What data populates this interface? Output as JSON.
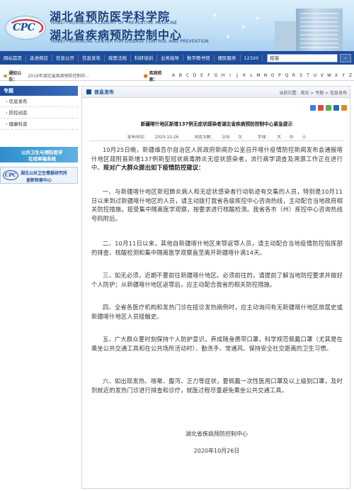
{
  "header": {
    "title_cn_1": "湖北省预防医学科学院",
    "title_en_1": "HUBEI PROVINCIAL ACADEMY OF PREVENTIVE MEDICINE",
    "title_cn_2": "湖北省疾病预防控制中心",
    "title_en_2": "HUBEI PROVINCIAL CENTER FOR DISEASE CONTROL AND PREVENTION",
    "logo_text": "CPC"
  },
  "nav": {
    "items": [
      "网站首页",
      "走进疾控",
      "信息公开",
      "信息发布",
      "政策法规",
      "科研培训",
      "业务指导",
      "数字图书馆",
      "便民服务",
      "12320"
    ],
    "search_value": "疫苗",
    "search_button": "›"
  },
  "notice": {
    "label": "通知公告：",
    "text": "2019年湖北省疾病预防控制中...",
    "disease_label": "疾病检索：",
    "letters": [
      "A",
      "B",
      "C",
      "D",
      "E",
      "F",
      "G",
      "H",
      "I",
      "J",
      "K",
      "L",
      "M",
      "N",
      "O",
      "P",
      "Q",
      "R",
      "S",
      "T",
      "U",
      "V",
      "W",
      "X",
      "Y",
      "Z"
    ]
  },
  "sidebar": {
    "heading": "专题",
    "items": [
      "信息发布",
      "防控动态",
      "健康科普"
    ],
    "banner1_text_1": "公共卫生与预防医学",
    "banner1_text_2": "在线审稿系统",
    "banner2_logo": "CPC",
    "banner2_text_1": "湖北公共卫生情报研究所",
    "banner2_text_2": "查新检索中心"
  },
  "content": {
    "section_title": "信息发布",
    "breadcrumb": "当前位置：首页 > 专题 > 信息发布",
    "article_title": "新疆喀什地区新增137例无症状感染者湖北省疾病预防控制中心紧急提示",
    "meta": {
      "date_label": "发布时间：",
      "date": "2020-10-26",
      "views_label": "浏览次数：",
      "views": "109",
      "views_unit": "次",
      "font_label": "字体：",
      "font_big": "大",
      "font_mid": "中",
      "font_small": "小"
    },
    "intro": "10月25日晚，新疆维吾尔自治区人民政府新闻办公室召开喀什疫情防控新闻发布会通报喀什地区疏附县新增137例新型冠状病毒肺炎无症状感染者，流行病学调查及溯源工作正在进行中。",
    "intro_bold": "现对广大群众提出如下疫情防控建议：",
    "points": [
      "一、与新疆喀什地区新冠肺炎病人和无症状感染者行动轨迹有交集的人员，特别是10月11日以来到过新疆喀什地区的人员，请主动拨打我省各级疾控中心咨询热线，主动配合当地政府相关防控措施，接受集中隔离医学观察，按要求进行核酸检测。我省各市（州）疾控中心咨询热线号码附后。",
      "二、10月11日以来，其他自新疆喀什地区来鄂返鄂人员，请主动配合当地疫情防控指挥部的排查、核酸检测和集中隔离医学观察直至离开新疆喀什满14天。",
      "三、如无必须，近期不要前往新疆喀什地区。必须前往的，请提前了解当地防控要求并做好个人防护；从新疆喀什地区返鄂后，应主动配合我省的相关防控措施。",
      "四、全省各医疗机构和发热门诊在接诊发热病例时，应主动询问有无新疆喀什地区旅居史或新疆喀什地区人员接触史。",
      "五、广大群众要时刻保持个人防护意识，养成随身携带口罩，科学规范佩戴口罩（尤其是在乘坐公共交通工具和在公共场所活动时）、勤洗手、常通风、保持安全社交距离的卫生习惯。",
      "六、如出现发热、咳嗽、腹泻、乏力等症状，要佩戴一次性医用口罩及以上级别口罩，及时到就近的发热门诊进行排查和诊疗，就医过程尽量避免乘坐公共交通工具。"
    ],
    "signature": "湖北省疾病预防控制中心",
    "sign_date": "2020年10月26日"
  }
}
